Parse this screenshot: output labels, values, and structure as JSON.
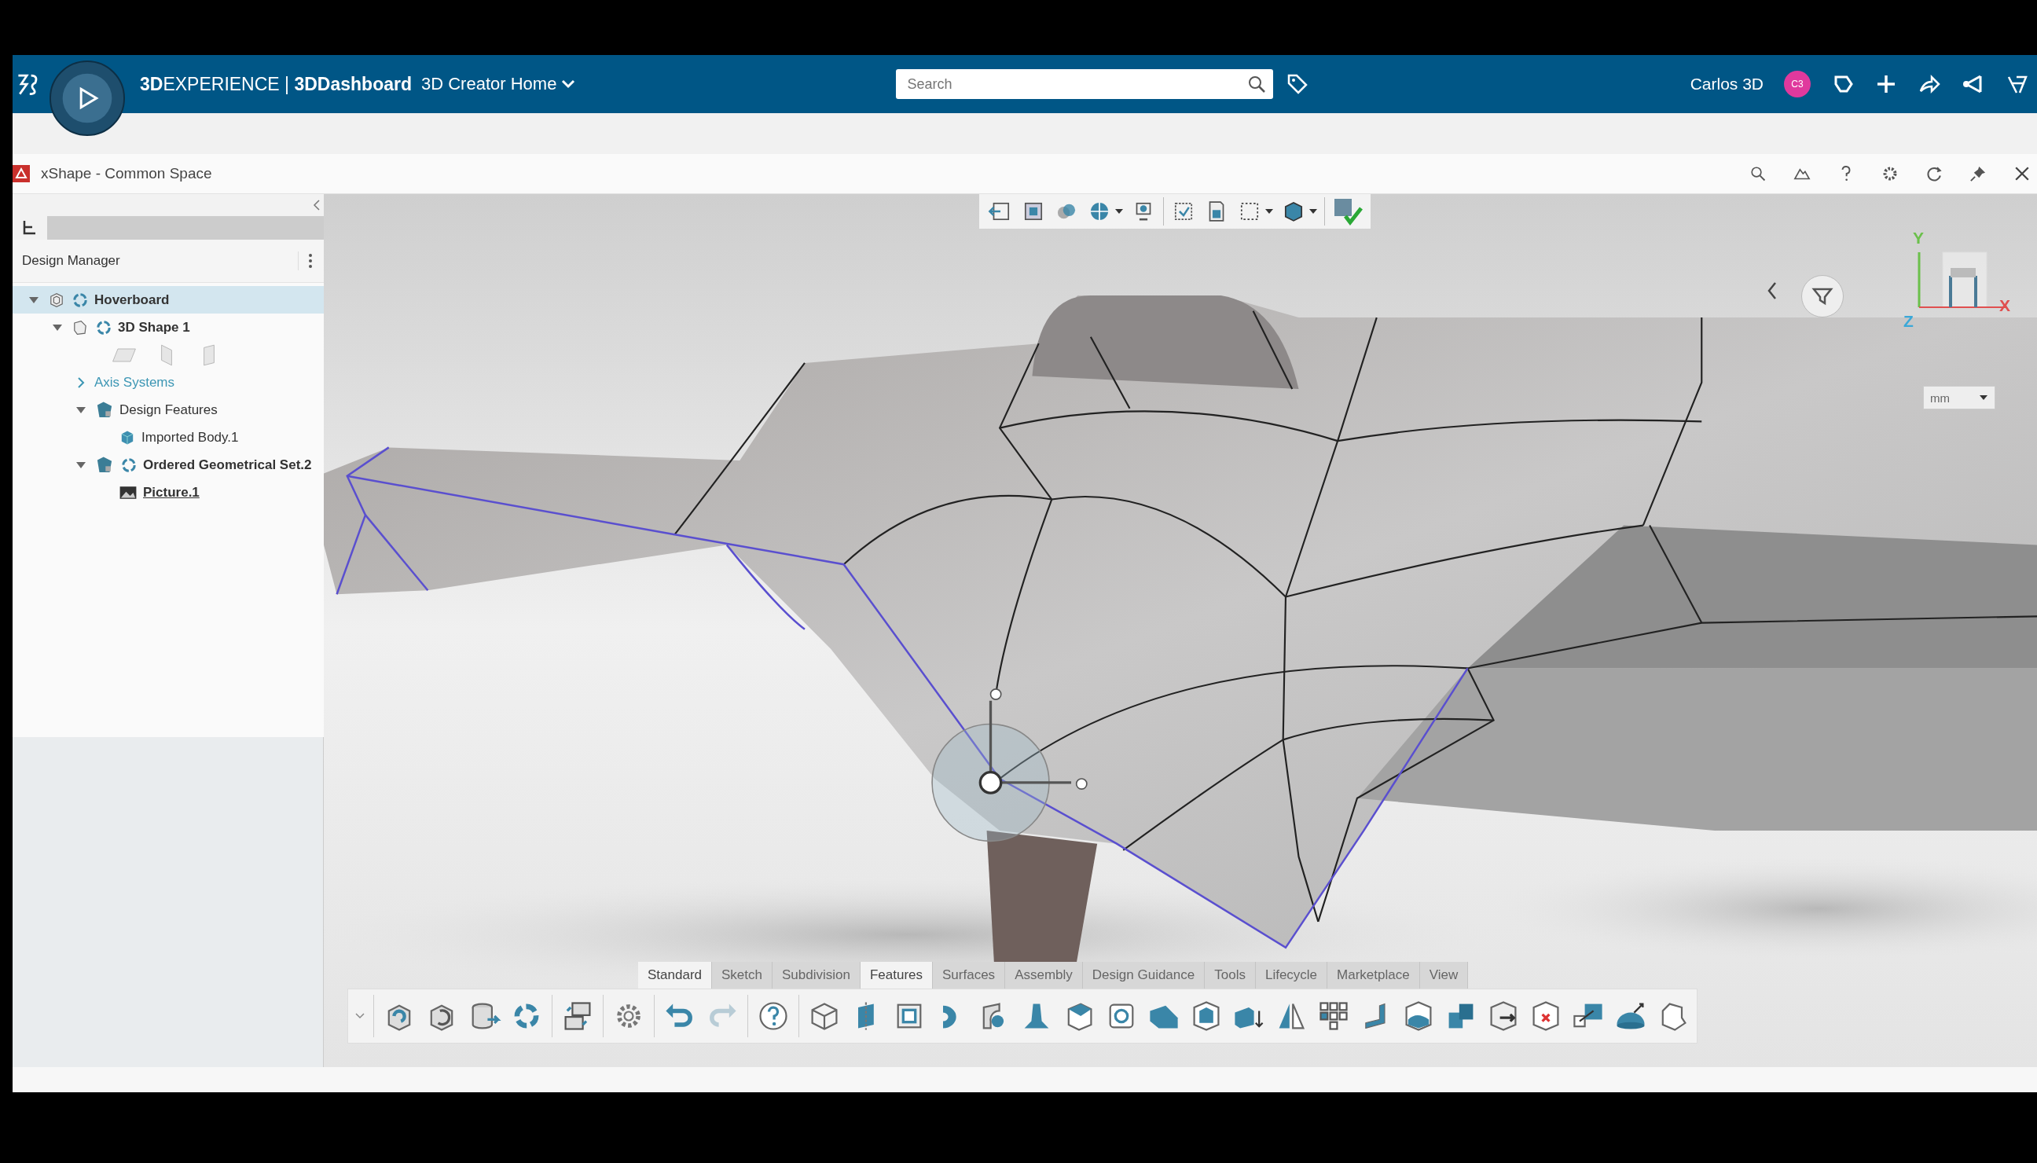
{
  "topbar": {
    "brand": "**3D**EXPERIENCE | **3DDashboard**",
    "app_menu": "3D Creator Home",
    "search": {
      "placeholder": "Search"
    },
    "user": "Carlos 3D",
    "avatar": "C3"
  },
  "app_title": "xShape - Common Space",
  "panel": {
    "title": "Design Manager",
    "tree": [
      {
        "label": "Hoverboard",
        "kind": "product",
        "expanded": true,
        "selected": true,
        "current": false,
        "children": [
          {
            "label": "3D Shape 1",
            "kind": "shape",
            "expanded": true,
            "selected": false,
            "current": false,
            "children": [
              {
                "kind": "planes",
                "selected": false
              },
              {
                "label": "Axis Systems",
                "kind": "axis",
                "expanded": false,
                "selected": false,
                "current": false
              },
              {
                "label": "Design Features",
                "kind": "features",
                "expanded": true,
                "selected": false,
                "current": false,
                "children": [
                  {
                    "label": "Imported Body.1",
                    "kind": "body",
                    "selected": false,
                    "current": false
                  }
                ]
              },
              {
                "label": "Ordered Geometrical Set.2",
                "kind": "set",
                "expanded": true,
                "selected": false,
                "current": false,
                "children": [
                  {
                    "label": "Picture.1",
                    "kind": "picture",
                    "selected": false,
                    "current": true
                  }
                ]
              }
            ]
          }
        ]
      }
    ]
  },
  "viewport": {
    "unit": "mm",
    "axes": [
      "Y",
      "X",
      "Z"
    ]
  },
  "tabs": [
    {
      "label": "Standard",
      "selected": true
    },
    {
      "label": "Sketch",
      "selected": false
    },
    {
      "label": "Subdivision",
      "selected": false
    },
    {
      "label": "Features",
      "selected": true
    },
    {
      "label": "Surfaces",
      "selected": false
    },
    {
      "label": "Assembly",
      "selected": false
    },
    {
      "label": "Design Guidance",
      "selected": false
    },
    {
      "label": "Tools",
      "selected": false
    },
    {
      "label": "Lifecycle",
      "selected": false
    },
    {
      "label": "Marketplace",
      "selected": false
    },
    {
      "label": "View",
      "selected": false
    }
  ]
}
